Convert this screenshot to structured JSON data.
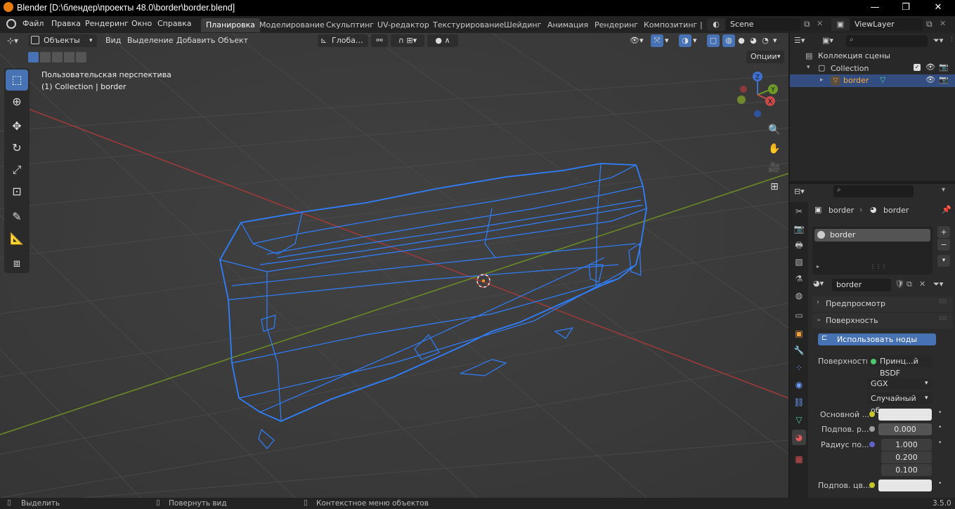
{
  "window": {
    "title": "Blender [D:\\блендер\\проекты 48.0\\border\\border.blend]",
    "minimize": "—",
    "maximize": "❐",
    "close": "✕"
  },
  "menu": {
    "items": [
      "Файл",
      "Правка",
      "Рендеринг",
      "Окно",
      "Справка"
    ]
  },
  "workspaces": [
    "Планировка",
    "Моделирование",
    "Скульптинг",
    "UV-редактор",
    "Текстурирование",
    "Шейдинг",
    "Анимация",
    "Рендеринг",
    "Композитинг",
    "|"
  ],
  "scene": {
    "name": "Scene",
    "viewlayer": "ViewLayer"
  },
  "viewport": {
    "mode": "Объекты",
    "menus": [
      "Вид",
      "Выделение",
      "Добавить",
      "Объект"
    ],
    "orientation": "Глоба...",
    "options_label": "Опции",
    "view_name": "Пользовательская перспектива",
    "view_sub": "(1) Collection | border",
    "gizmo": {
      "z": "Z",
      "y": "Y",
      "x": "X"
    }
  },
  "outliner": {
    "search_placeholder": "",
    "scene_collection": "Коллекция сцены",
    "collection": "Collection",
    "object": "border"
  },
  "properties": {
    "breadcrumb_object": "border",
    "breadcrumb_material": "border",
    "slot_name": "border",
    "material_name": "border",
    "preview_label": "Предпросмотр",
    "surface_panel": "Поверхность",
    "use_nodes": "Использовать ноды",
    "surface_label": "Поверхность",
    "surface_value": "Принц...й BSDF",
    "distribution": "GGX",
    "subsurface_method": "Случайный об...",
    "base_color_label": "Основной ...",
    "subsurface_label": "Подпов. р...",
    "subsurface_value": "0.000",
    "radius_label": "Радиус по...",
    "radius_values": [
      "1.000",
      "0.200",
      "0.100"
    ],
    "subsurface_color_label": "Подпов. цв..."
  },
  "status": {
    "select": "Выделить",
    "rotate": "Повернуть вид",
    "context": "Контекстное меню объектов",
    "version": "3.5.0"
  },
  "colors": {
    "accent": "#4772b3",
    "wire": "#2f7fff",
    "x_axis": "#b03a3a",
    "y_axis": "#6c8e22"
  }
}
